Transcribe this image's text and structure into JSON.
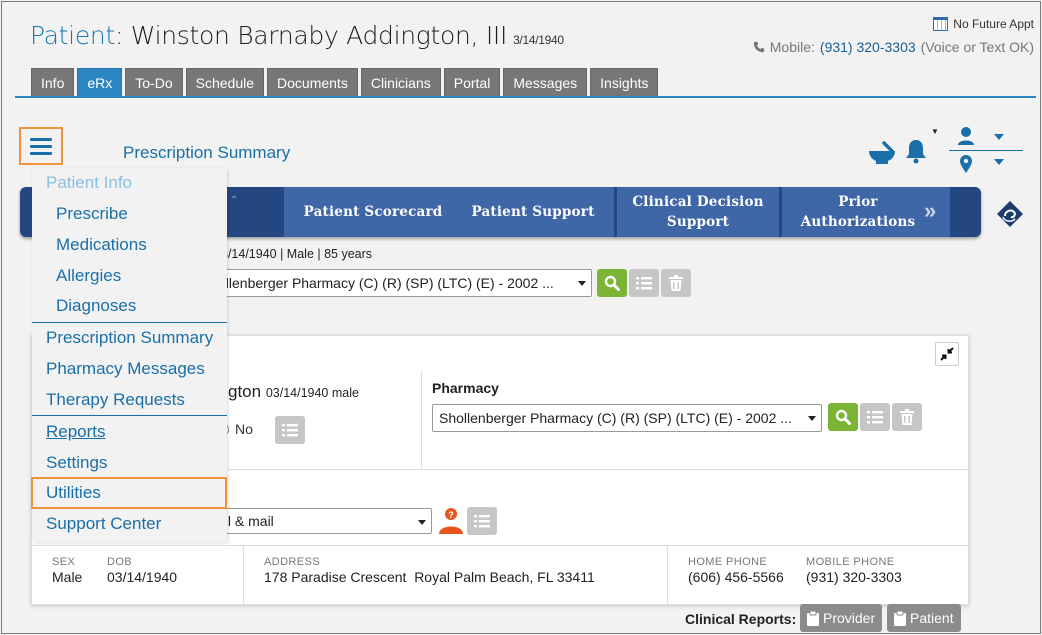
{
  "patient": {
    "label": "Patient",
    "name": "Winston Barnaby Addington, III",
    "dob": "3/14/1940"
  },
  "header_right": {
    "appointment": "No Future Appt",
    "mobile_label": "Mobile:",
    "mobile_number": "(931) 320-3303",
    "mobile_note": "(Voice or Text OK)"
  },
  "tabs": [
    {
      "label": "Info"
    },
    {
      "label": "eRx"
    },
    {
      "label": "To-Do"
    },
    {
      "label": "Schedule"
    },
    {
      "label": "Documents"
    },
    {
      "label": "Clinicians"
    },
    {
      "label": "Portal"
    },
    {
      "label": "Messages"
    },
    {
      "label": "Insights"
    }
  ],
  "page_heading": "Prescription Summary",
  "navbar": {
    "buttons": [
      {
        "label": "Patient Scorecard"
      },
      {
        "label": "Patient Support"
      },
      {
        "label": "Clinical Decision Support"
      },
      {
        "label": "Prior Authorizations"
      }
    ]
  },
  "demographics_line": "3/14/1940 | Male | 85 years",
  "pharmacy_select_top": "ollenberger Pharmacy (C) (R) (SP) (LTC) (E) - 2002 ...",
  "card": {
    "patient_fragment": "gton",
    "patient_fragment_meta": "03/14/1940 male",
    "radio_no": "No",
    "pharmacy_label": "Pharmacy",
    "pharmacy_select": "Shollenberger Pharmacy (C) (R) (SP) (LTC) (E) - 2002 ...",
    "mail_select": "ail & mail",
    "info": {
      "sex_label": "SEX",
      "sex": "Male",
      "dob_label": "DOB",
      "dob": "03/14/1940",
      "address_label": "ADDRESS",
      "address": "178 Paradise Crescent  Royal Palm Beach, FL 33411",
      "home_phone_label": "HOME PHONE",
      "home_phone": "(606) 456-5566",
      "mobile_phone_label": "MOBILE PHONE",
      "mobile_phone": "(931) 320-3303"
    }
  },
  "clinical_reports": {
    "label": "Clinical Reports:",
    "provider": "Provider",
    "patient": "Patient"
  },
  "side_menu": {
    "patient_info": "Patient Info",
    "prescribe": "Prescribe",
    "medications": "Medications",
    "allergies": "Allergies",
    "diagnoses": "Diagnoses",
    "prescription_summary": "Prescription Summary",
    "pharmacy_messages": "Pharmacy Messages",
    "therapy_requests": "Therapy Requests",
    "reports": "Reports",
    "settings": "Settings",
    "utilities": "Utilities",
    "support_center": "Support Center"
  },
  "colors": {
    "brand_blue": "#1a6fa8",
    "active_tab": "#2c86c2",
    "navbar": "#244781",
    "highlight": "#f0943a",
    "search_green": "#7cb434"
  }
}
